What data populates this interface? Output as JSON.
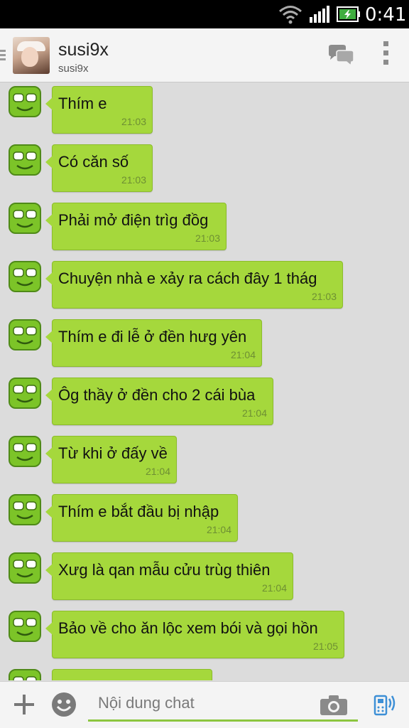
{
  "status": {
    "time": "0:41"
  },
  "header": {
    "name": "susi9x",
    "subname": "susi9x"
  },
  "messages": [
    {
      "text": "Thím e",
      "time": "21:03"
    },
    {
      "text": "Có căn số",
      "time": "21:03"
    },
    {
      "text": "Phải mở điện trìg đồg",
      "time": "21:03"
    },
    {
      "text": "Chuyện nhà e xảy ra cách đây 1 thág",
      "time": "21:03"
    },
    {
      "text": "Thím e đi lễ ở đền hưg yên",
      "time": "21:04"
    },
    {
      "text": "Ôg thầy ở đền cho 2 cái bùa",
      "time": "21:04"
    },
    {
      "text": "Từ khi ở đấy về",
      "time": "21:04"
    },
    {
      "text": "Thím e bắt đầu bị nhập",
      "time": "21:04"
    },
    {
      "text": "Xưg là qan mẫu cửu trùg thiên",
      "time": "21:04"
    },
    {
      "text": "Bảo về cho ăn lộc xem bói và gọi hồn",
      "time": "21:05"
    },
    {
      "text": "",
      "time": ""
    }
  ],
  "input": {
    "placeholder": "Nội dung chat"
  },
  "icons": {
    "wifi": "wifi-icon",
    "signal": "signal-icon",
    "battery": "battery-charging-icon",
    "chat": "chat-bubbles-icon",
    "menu": "overflow-menu-icon",
    "add": "plus-icon",
    "emoji": "emoji-icon",
    "camera": "camera-icon",
    "voice": "voice-input-icon"
  },
  "colors": {
    "bubble": "#a5d83c",
    "accent": "#8cc63f",
    "statusbar": "#000000"
  }
}
